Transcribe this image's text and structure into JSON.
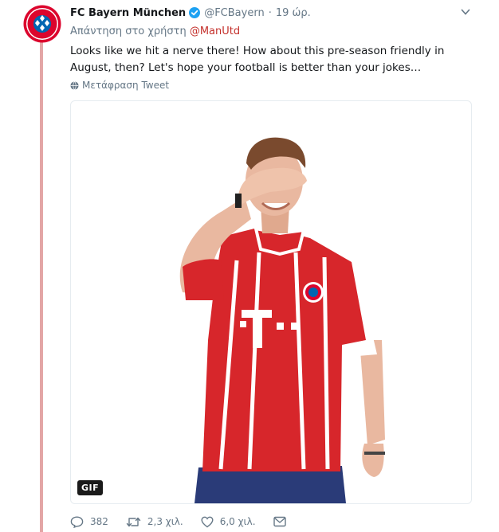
{
  "author": {
    "name": "FC Bayern München",
    "handle": "@FCBayern",
    "separator": "·",
    "time": "19 ώρ.",
    "verified": true,
    "avatar_text": "FC BAYERN MÜNCHEN"
  },
  "reply": {
    "prefix": "Απάντηση στο χρήστη",
    "mention": "@ManUtd"
  },
  "tweet": {
    "text": "Looks like we hit a nerve there! How about this pre-season friendly in August, then? Let's hope your football is better than your jokes…",
    "translate_label": "Μετάφραση Tweet"
  },
  "media": {
    "badge": "GIF"
  },
  "actions": {
    "replies": "382",
    "retweets": "2,3 χιλ.",
    "likes": "6,0 χιλ."
  },
  "colors": {
    "mention": "#c4302b",
    "verified": "#1da1f2",
    "thread_line": "#e3a6a6",
    "jersey_red": "#d7262b"
  },
  "icons": [
    "bayern-logo-icon",
    "verified-icon",
    "chevron-down-icon",
    "globe-icon",
    "reply-icon",
    "retweet-icon",
    "heart-icon",
    "message-icon"
  ]
}
